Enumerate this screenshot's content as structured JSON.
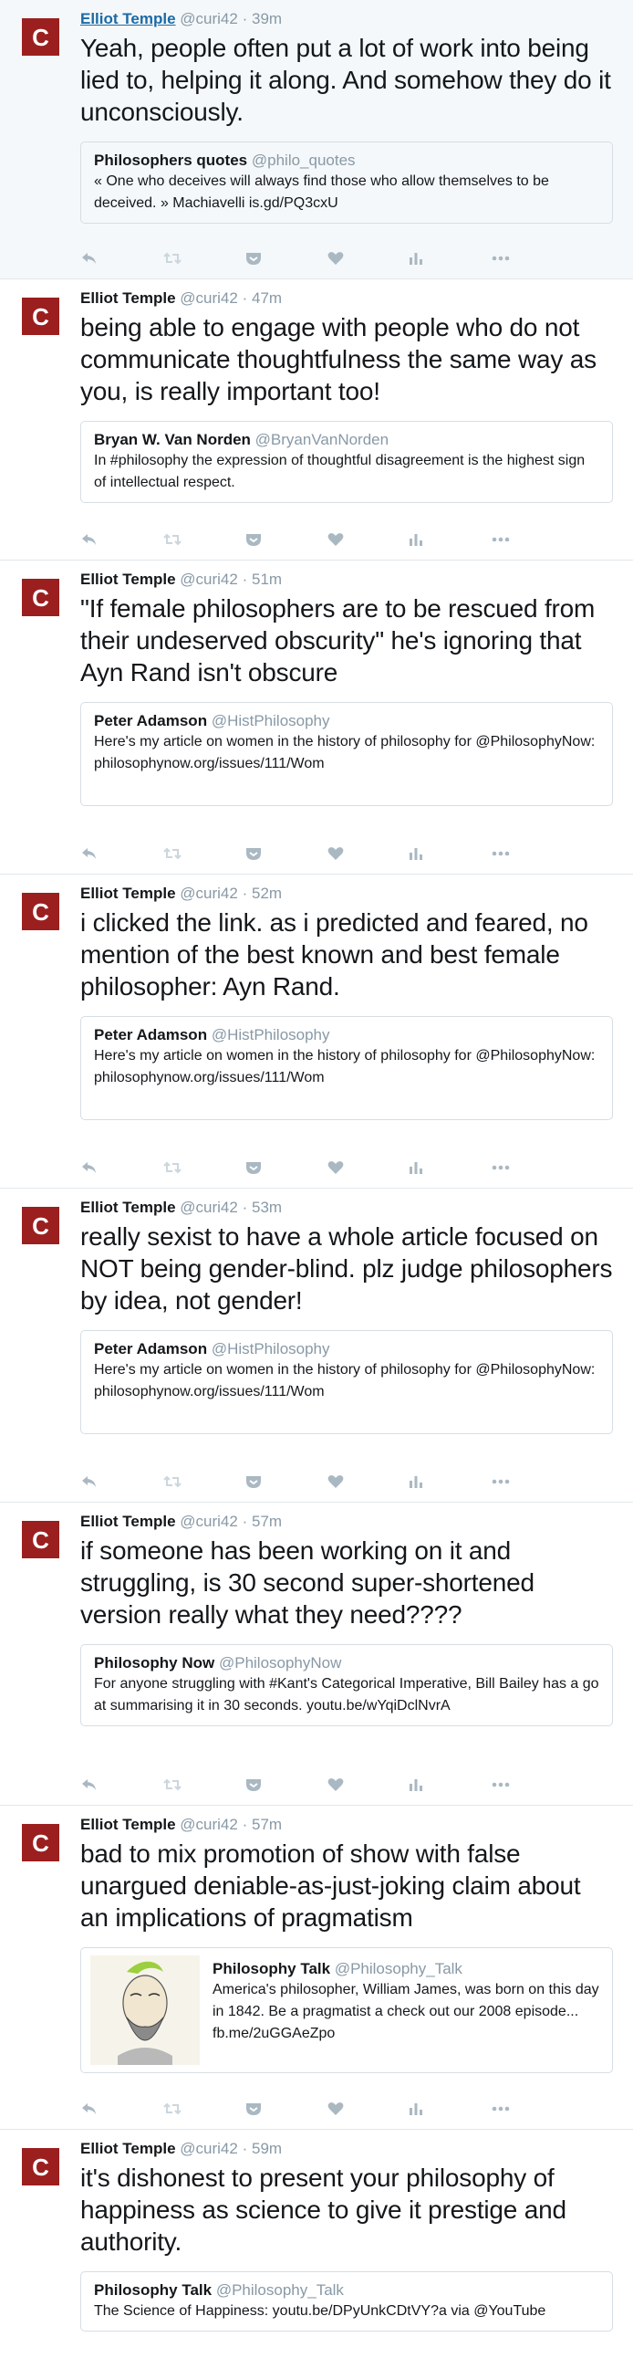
{
  "tweets": [
    {
      "author": "Elliot Temple",
      "handle": "@curi42",
      "time": "39m",
      "avatar_letter": "C",
      "text": "Yeah, people often put a lot of work into being lied to, helping it along. And somehow they do it unconsciously.",
      "quote": {
        "name": "Philosophers quotes",
        "handle": "@philo_quotes",
        "text": "« One who deceives will always find those who allow themselves to be deceived. » Machiavelli   is.gd/PQ3cxU"
      }
    },
    {
      "author": "Elliot Temple",
      "handle": "@curi42",
      "time": "47m",
      "avatar_letter": "C",
      "text": "being able to engage with people who do not communicate thoughtfulness the same way as you, is really important too!",
      "quote": {
        "name": "Bryan W. Van Norden",
        "handle": "@BryanVanNorden",
        "text": "In #philosophy the expression of thoughtful disagreement is the highest sign of intellectual respect."
      }
    },
    {
      "author": "Elliot Temple",
      "handle": "@curi42",
      "time": "51m",
      "avatar_letter": "C",
      "text": "\"If female philosophers are to be rescued from their undeserved obscurity\" he's ignoring that Ayn Rand isn't obscure",
      "quote": {
        "name": "Peter Adamson",
        "handle": "@HistPhilosophy",
        "text": "Here's my article on women in the history of philosophy for @PhilosophyNow: philosophynow.org/issues/111/Wom"
      }
    },
    {
      "author": "Elliot Temple",
      "handle": "@curi42",
      "time": "52m",
      "avatar_letter": "C",
      "text": "i clicked the link. as i predicted and feared, no mention of the best known and best female philosopher: Ayn Rand.",
      "quote": {
        "name": "Peter Adamson",
        "handle": "@HistPhilosophy",
        "text": "Here's my article on women in the history of philosophy for @PhilosophyNow: philosophynow.org/issues/111/Wom"
      }
    },
    {
      "author": "Elliot Temple",
      "handle": "@curi42",
      "time": "53m",
      "avatar_letter": "C",
      "text": "really sexist to have a whole article focused on NOT being gender-blind. plz judge philosophers by idea, not gender!",
      "quote": {
        "name": "Peter Adamson",
        "handle": "@HistPhilosophy",
        "text": "Here's my article on women in the history of philosophy for @PhilosophyNow: philosophynow.org/issues/111/Wom"
      }
    },
    {
      "author": "Elliot Temple",
      "handle": "@curi42",
      "time": "57m",
      "avatar_letter": "C",
      "text": "if someone has been working on it and struggling, is 30 second super-shortened version really what they need????",
      "quote": {
        "name": "Philosophy Now",
        "handle": "@PhilosophyNow",
        "text": "For anyone struggling with #Kant's Categorical Imperative, Bill Bailey has a go at summarising it in 30 seconds. youtu.be/wYqiDclNvrA"
      }
    },
    {
      "author": "Elliot Temple",
      "handle": "@curi42",
      "time": "57m",
      "avatar_letter": "C",
      "text": "bad to mix promotion of show with false unargued deniable-as-just-joking claim about an implications of pragmatism",
      "quote": {
        "name": "Philosophy Talk",
        "handle": "@Philosophy_Talk",
        "text": "America's philosopher, William James, was born on this day in 1842. Be a pragmatist a check out our 2008 episode... fb.me/2uGGAeZpo"
      }
    },
    {
      "author": "Elliot Temple",
      "handle": "@curi42",
      "time": "59m",
      "avatar_letter": "C",
      "text": "it's dishonest to present your philosophy of happiness as science to give it prestige and authority.",
      "quote": {
        "name": "Philosophy Talk",
        "handle": "@Philosophy_Talk",
        "text": "The Science of Happiness: youtu.be/DPyUnkCDtVY?a via @YouTube"
      }
    }
  ],
  "header_dot": "·",
  "icons": [
    "reply-icon",
    "retweet-icon",
    "pocket-icon",
    "like-icon",
    "analytics-icon",
    "more-icon"
  ],
  "colors": {
    "avatar_bg": "#9b1f1f",
    "meta_gray": "#8899a6",
    "link_blue": "#1b6aa5",
    "border": "#e1e8ed",
    "icon_gray": "#aab8c2",
    "icon_light": "#ccd6dd"
  }
}
